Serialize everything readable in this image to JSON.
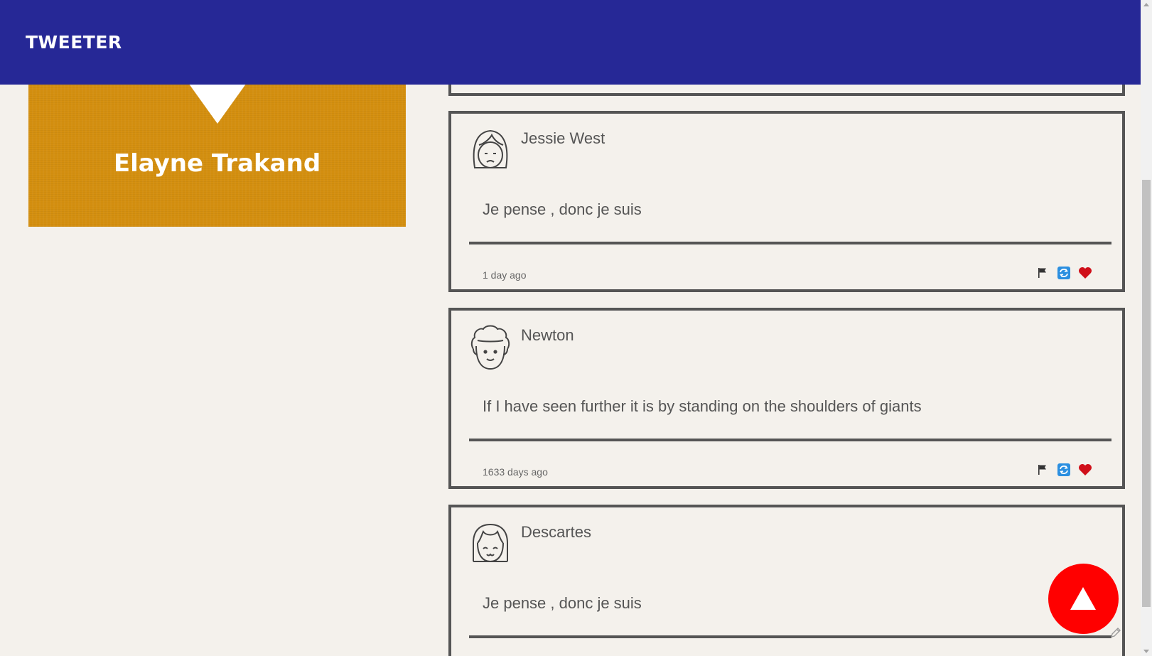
{
  "header": {
    "brand": "TWEETER"
  },
  "profile": {
    "name": "Elayne Trakand"
  },
  "colors": {
    "header_bg": "#262896",
    "profile_bg": "#d48f0f",
    "page_bg": "#f4f1ec",
    "to_top_bg": "#ff0000"
  },
  "tweets": [
    {
      "author": "",
      "content": "",
      "time": "",
      "avatar_icon": "face-icon"
    },
    {
      "author": "Jessie West",
      "content": "Je pense , donc je suis",
      "time": "1 day ago",
      "avatar_icon": "woman-face-icon"
    },
    {
      "author": "Newton",
      "content": "If I have seen further it is by standing on the shoulders of giants",
      "time": "1633 days ago",
      "avatar_icon": "curly-hair-face-icon"
    },
    {
      "author": "Descartes",
      "content": "Je pense , donc je suis",
      "time": "",
      "avatar_icon": "bangs-face-icon"
    }
  ],
  "actions": {
    "flag_icon": "flag-icon",
    "retweet_icon": "retweet-icon",
    "like_icon": "heart-icon"
  },
  "to_top_icon": "arrow-up-icon"
}
